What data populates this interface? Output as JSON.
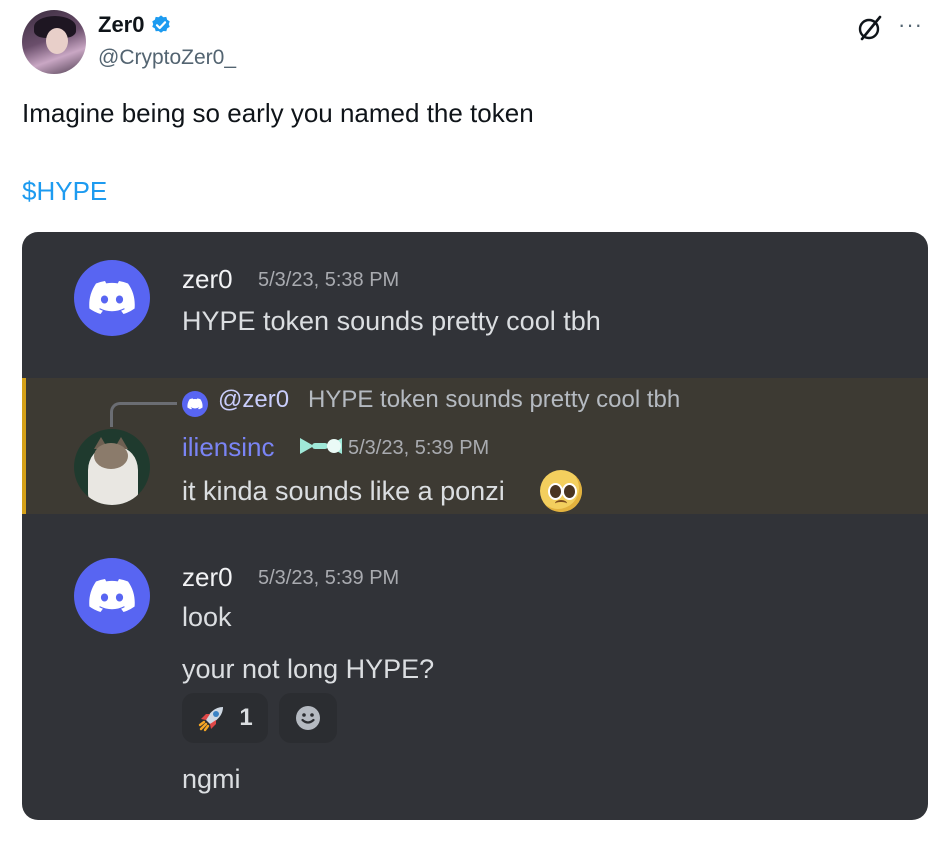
{
  "tweet": {
    "author_name": "Zer0",
    "author_handle": "@CryptoZer0_",
    "text": "Imagine being so early you named the token",
    "cashtag": "$HYPE"
  },
  "discord": {
    "messages": [
      {
        "user": "zer0",
        "timestamp": "5/3/23, 5:38 PM",
        "lines": [
          "HYPE token sounds pretty cool tbh"
        ]
      },
      {
        "reply_to": {
          "mention": "@zer0",
          "text": "HYPE token sounds pretty cool tbh"
        },
        "user": "iliensinc",
        "timestamp": "5/3/23, 5:39 PM",
        "lines": [
          "it kinda sounds like a ponzi"
        ],
        "emoji": "pleading-face"
      },
      {
        "user": "zer0",
        "timestamp": "5/3/23, 5:39 PM",
        "lines": [
          "look",
          "your not long HYPE?",
          "ngmi"
        ],
        "reactions": [
          {
            "emoji": "rocket",
            "count": "1"
          }
        ]
      }
    ]
  },
  "colors": {
    "discord_bg": "#313338",
    "discord_blurple": "#5865f2",
    "reply_highlight_bg": "#3d3a33",
    "reply_highlight_border": "#d4a018",
    "username_iliensinc": "#7a84f5",
    "link_blue": "#1d9bf0",
    "verified_blue": "#1d9bf0"
  }
}
